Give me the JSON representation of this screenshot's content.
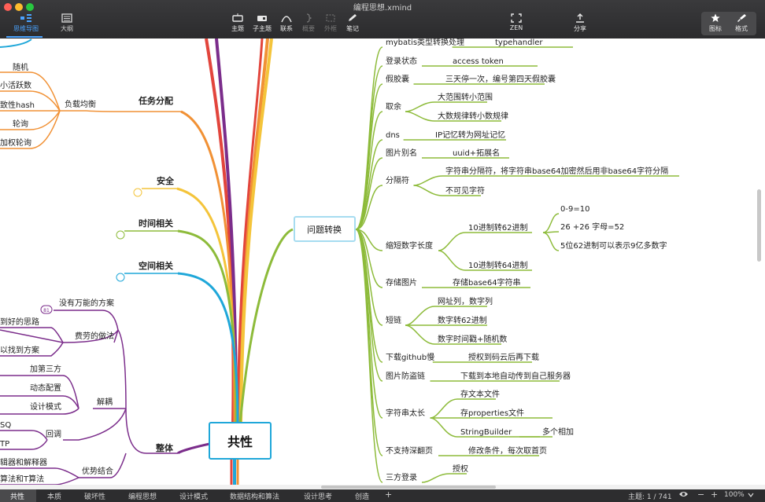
{
  "window": {
    "title": "编程思想.xmind"
  },
  "view_tabs": {
    "mindmap": "思维导图",
    "outline": "大纲"
  },
  "toolbar": {
    "topic": "主题",
    "subtopic": "子主题",
    "relation": "联系",
    "summary": "概要",
    "boundary": "外框",
    "note": "笔记",
    "zen": "ZEN",
    "share": "分享",
    "icon": "图标",
    "format": "格式"
  },
  "mindmap": {
    "central": "共性",
    "main_topic": "问题转换",
    "left": {
      "task_alloc": "任务分配",
      "load_balance": "负载均衡",
      "lb_items": [
        "随机",
        "小活跃数",
        "致性hash",
        "轮询",
        "加权轮询"
      ],
      "security": "安全",
      "time": "时间相关",
      "space": "空间相关",
      "no_universal": "没有万能的方案",
      "costly": "费劳的做法",
      "costly_items": [
        "到好的思路",
        "以找到方案"
      ],
      "whole": "整体",
      "decouple": "解耦",
      "decouple_items": [
        "加第三方",
        "动态配置",
        "设计模式"
      ],
      "callback": "回调",
      "callback_items": [
        "SQ",
        "TP"
      ],
      "combine": "优势结合",
      "combine_items": [
        "辑器和解释器",
        "算法和T算法"
      ],
      "marker_81": "81"
    },
    "right": [
      {
        "label": "mybatis类型转换处理",
        "children": [
          "typehandler"
        ]
      },
      {
        "label": "登录状态",
        "children": [
          "access token"
        ]
      },
      {
        "label": "假胶囊",
        "children": [
          "三天停一次，编号第四天假胶囊"
        ]
      },
      {
        "label": "取余",
        "children": [
          "大范围转小范围",
          "大数规律转小数规律"
        ]
      },
      {
        "label": "dns",
        "children": [
          "IP记忆转为网址记忆"
        ]
      },
      {
        "label": "图片别名",
        "children": [
          "uuid+拓展名"
        ]
      },
      {
        "label": "分隔符",
        "children": [
          "字符串分隔符，将字符串base64加密然后用非base64字符分隔",
          "不可见字符"
        ]
      },
      {
        "label": "缩短数字长度",
        "children": [
          "10进制转62进制",
          "10进制转64进制"
        ],
        "grandchildren": [
          "0-9=10",
          "26 +26 字母=52",
          "5位62进制可以表示9亿多数字"
        ]
      },
      {
        "label": "存储图片",
        "children": [
          "存储base64字符串"
        ]
      },
      {
        "label": "短链",
        "children": [
          "网址列，数字列",
          "数字转62进制",
          "数字时间戳+随机数"
        ]
      },
      {
        "label": "下载github慢",
        "children": [
          "授权到码云后再下载"
        ]
      },
      {
        "label": "图片防盗链",
        "children": [
          "下载到本地自动传到自己服务器"
        ]
      },
      {
        "label": "字符串太长",
        "children": [
          "存文本文件",
          "存properties文件",
          "StringBuilder"
        ],
        "extra": "多个相加"
      },
      {
        "label": "不支持深翻页",
        "children": [
          "修改条件，每次取首页"
        ]
      },
      {
        "label": "三方登录",
        "children": [
          "授权"
        ]
      }
    ]
  },
  "bottom": {
    "sheets": [
      "共性",
      "本质",
      "破坏性",
      "编程思想",
      "设计模式",
      "数据结构和算法",
      "设计思考",
      "创造"
    ],
    "add": "+",
    "topic_count": "主题: 1 / 741",
    "zoom": "100%",
    "minus": "−",
    "plus": "+"
  },
  "colors": {
    "green": "#8dbb3a",
    "orange": "#f19135",
    "yellow": "#f4c43a",
    "blue": "#1fa7d9",
    "purple": "#7b2d8b",
    "red": "#e2453c",
    "highlight": "#a6dcf0"
  }
}
